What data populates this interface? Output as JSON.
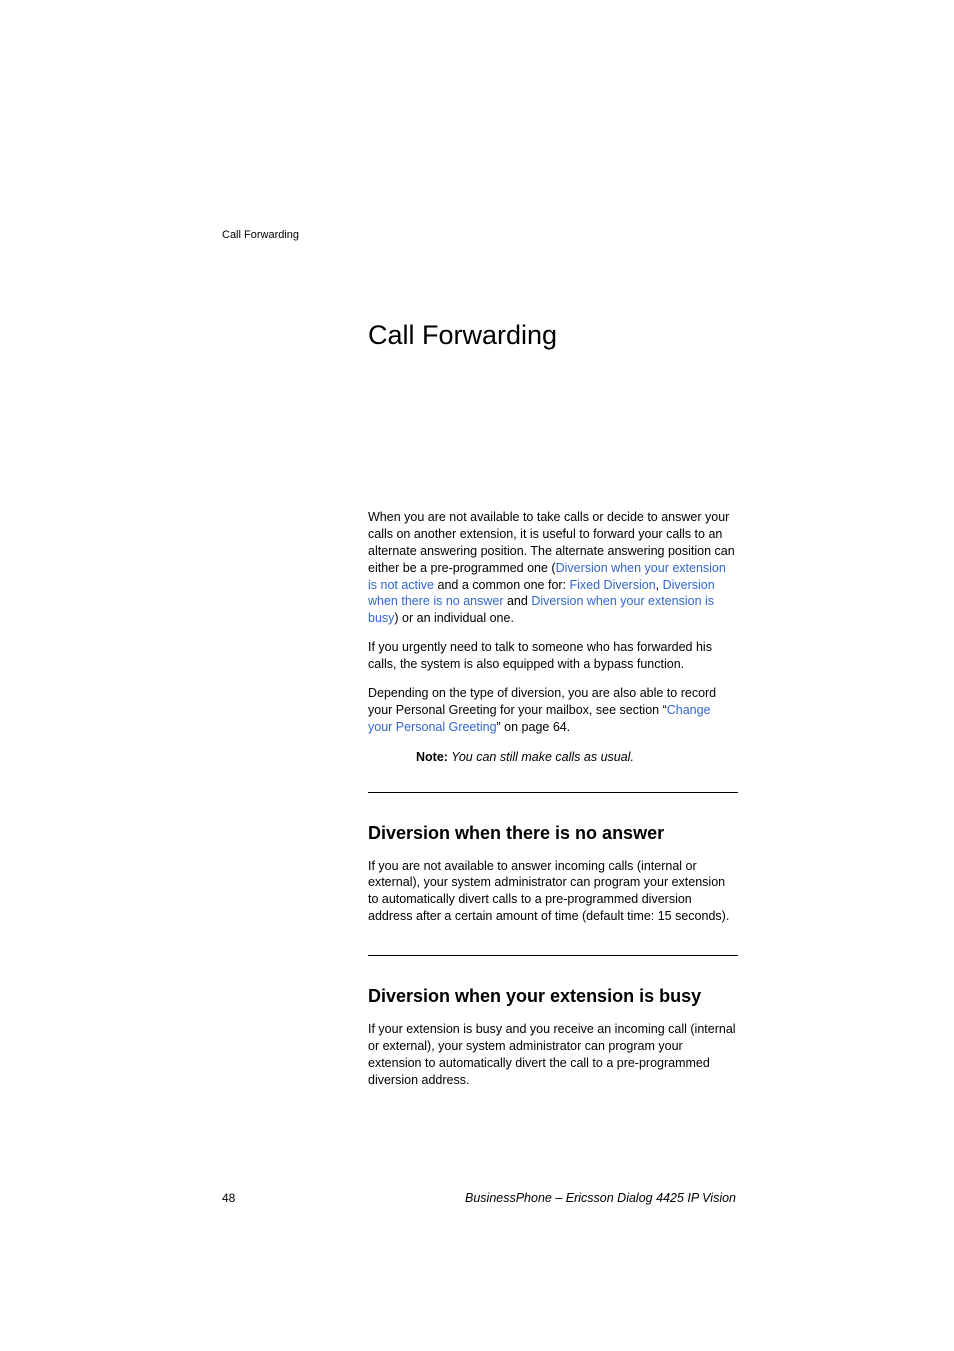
{
  "header": {
    "section_name": "Call Forwarding"
  },
  "main": {
    "title": "Call Forwarding",
    "intro_p1_part1": "When you are not available to take calls or decide to answer your calls on another extension, it is useful to forward your calls to an alternate answering position. The alternate answering position can either be a pre-programmed one (",
    "link1": "Diversion when your extension is not active",
    "intro_p1_part2": " and a common one for: ",
    "link2": "Fixed Diversion",
    "intro_p1_part3": ", ",
    "link3": "Diversion when there is no answer",
    "intro_p1_part4": " and ",
    "link4": "Diversion when your extension is busy",
    "intro_p1_part5": ") or an individual one.",
    "intro_p2": "If you urgently need to talk to someone who has forwarded his calls, the system is also equipped with a bypass function.",
    "intro_p3_part1": "Depending on the type of diversion, you are also able to record your Personal Greeting for your mailbox, see section “",
    "link5": "Change your Personal Greeting",
    "intro_p3_part2": "” on page 64.",
    "note_label": "Note:",
    "note_text": " You can still make calls as usual.",
    "section1": {
      "heading": "Diversion when there is no answer",
      "body": "If you are not available to answer incoming calls (internal or external), your system administrator can program your extension to automatically divert calls to a pre-programmed diversion address after a certain amount of time (default time: 15 seconds)."
    },
    "section2": {
      "heading": "Diversion when your extension is busy",
      "body": "If your extension is busy and you receive an incoming call (internal or external), your system administrator can program your extension to automatically divert the call to a pre-programmed diversion address."
    }
  },
  "footer": {
    "page_number": "48",
    "publication": "BusinessPhone – Ericsson Dialog 4425 IP Vision"
  }
}
